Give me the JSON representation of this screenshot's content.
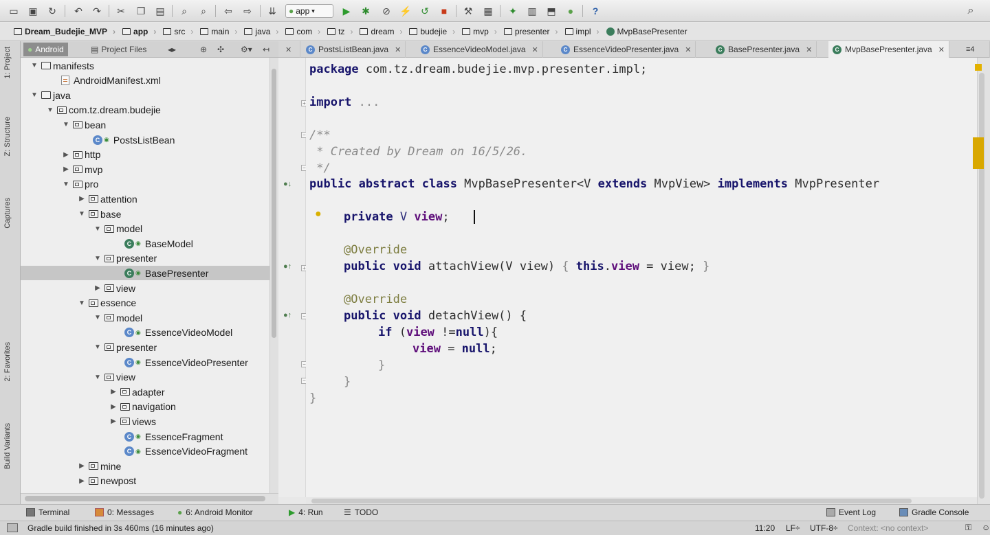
{
  "toolbar": {
    "run_config": "app",
    "buttons": [
      "open-icon",
      "save-all-icon",
      "sync-icon",
      "undo-icon",
      "redo-icon",
      "cut-icon",
      "copy-icon",
      "paste-icon",
      "find-icon",
      "replace-icon",
      "back-icon",
      "forward-icon",
      "make-project-icon",
      "run-icon",
      "debug-icon",
      "attach-debugger-icon",
      "apply-changes-icon",
      "rerun-icon",
      "stop-icon",
      "project-structure-icon",
      "sdk-manager-icon",
      "avd-manager-icon",
      "device-monitor-icon",
      "android-icon",
      "help-icon",
      "search-everywhere-icon"
    ]
  },
  "breadcrumb": [
    "Dream_Budejie_MVP",
    "app",
    "src",
    "main",
    "java",
    "com",
    "tz",
    "dream",
    "budejie",
    "mvp",
    "presenter",
    "impl",
    "MvpBasePresenter"
  ],
  "left_stripe": {
    "project": "1: Project",
    "structure": "Z: Structure",
    "captures": "Captures",
    "favorites": "2: Favorites",
    "build_variants": "Build Variants"
  },
  "project_panel": {
    "tab_android": "Android",
    "tab_project_files": "Project Files",
    "tree": [
      {
        "label": "manifests",
        "icon": "folder",
        "depth": 1,
        "toggle": "▼"
      },
      {
        "label": "AndroidManifest.xml",
        "icon": "xml",
        "depth": 2,
        "toggle": ""
      },
      {
        "label": "java",
        "icon": "folder",
        "depth": 1,
        "toggle": "▼"
      },
      {
        "label": "com.tz.dream.budejie",
        "icon": "package",
        "depth": 2,
        "toggle": "▼"
      },
      {
        "label": "bean",
        "icon": "package",
        "depth": 3,
        "toggle": "▼"
      },
      {
        "label": "PostsListBean",
        "icon": "class",
        "depth": 4,
        "toggle": ""
      },
      {
        "label": "http",
        "icon": "package",
        "depth": 3,
        "toggle": "▶"
      },
      {
        "label": "mvp",
        "icon": "package",
        "depth": 3,
        "toggle": "▶"
      },
      {
        "label": "pro",
        "icon": "package",
        "depth": 3,
        "toggle": "▼"
      },
      {
        "label": "attention",
        "icon": "package",
        "depth": 4,
        "toggle": "▶"
      },
      {
        "label": "base",
        "icon": "package",
        "depth": 4,
        "toggle": "▼"
      },
      {
        "label": "model",
        "icon": "package",
        "depth": 5,
        "toggle": "▼"
      },
      {
        "label": "BaseModel",
        "icon": "class-alt",
        "depth": 6,
        "toggle": ""
      },
      {
        "label": "presenter",
        "icon": "package",
        "depth": 5,
        "toggle": "▼"
      },
      {
        "label": "BasePresenter",
        "icon": "class-alt",
        "depth": 6,
        "toggle": "",
        "selected": true
      },
      {
        "label": "view",
        "icon": "package",
        "depth": 5,
        "toggle": "▶"
      },
      {
        "label": "essence",
        "icon": "package",
        "depth": 4,
        "toggle": "▼"
      },
      {
        "label": "model",
        "icon": "package",
        "depth": 5,
        "toggle": "▼"
      },
      {
        "label": "EssenceVideoModel",
        "icon": "class",
        "depth": 6,
        "toggle": ""
      },
      {
        "label": "presenter",
        "icon": "package",
        "depth": 5,
        "toggle": "▼"
      },
      {
        "label": "EssenceVideoPresenter",
        "icon": "class",
        "depth": 6,
        "toggle": ""
      },
      {
        "label": "view",
        "icon": "package",
        "depth": 5,
        "toggle": "▼"
      },
      {
        "label": "adapter",
        "icon": "package",
        "depth": 6,
        "toggle": "▶"
      },
      {
        "label": "navigation",
        "icon": "package",
        "depth": 6,
        "toggle": "▶"
      },
      {
        "label": "views",
        "icon": "package",
        "depth": 6,
        "toggle": "▶"
      },
      {
        "label": "EssenceFragment",
        "icon": "class",
        "depth": 6,
        "toggle": ""
      },
      {
        "label": "EssenceVideoFragment",
        "icon": "class",
        "depth": 6,
        "toggle": ""
      },
      {
        "label": "mine",
        "icon": "package",
        "depth": 4,
        "toggle": "▶"
      },
      {
        "label": "newpost",
        "icon": "package",
        "depth": 4,
        "toggle": "▶"
      }
    ]
  },
  "editor_tabs": [
    {
      "label": "PostsListBean.java",
      "icon": "class",
      "active": false
    },
    {
      "label": "EssenceVideoModel.java",
      "icon": "class",
      "active": false
    },
    {
      "label": "EssenceVideoPresenter.java",
      "icon": "class",
      "active": false
    },
    {
      "label": "BasePresenter.java",
      "icon": "class-alt",
      "active": false
    },
    {
      "label": "MvpBasePresenter.java",
      "icon": "class-alt",
      "active": true
    }
  ],
  "editor_tabs_overflow": "≡4",
  "code": {
    "package_kw": "package",
    "package_name": " com.tz.dream.budejie.mvp.presenter.impl;",
    "import_kw": "import",
    "import_rest": " ...",
    "comment_1": "/**",
    "comment_2": " * Created by Dream on 16/5/26.",
    "comment_3": " */",
    "class_decl": {
      "kw1": "public abstract class",
      "name": " MvpBasePresenter<V ",
      "kw2": "extends",
      "mid": " MvpView> ",
      "kw3": "implements",
      "tail": " MvpPresenter"
    },
    "field": {
      "kw": "private",
      "type": " V ",
      "name": "view",
      "end": ";"
    },
    "override_1": "@Override",
    "attach": {
      "kw": "public void",
      "sig": " attachView(V view) ",
      "body_open": "{ ",
      "this_kw": "this",
      "dot": ".",
      "field": "view",
      "rest": " = view; ",
      "body_close": "}"
    },
    "override_2": "@Override",
    "detach": {
      "kw": "public void",
      "sig": " detachView() {"
    },
    "if_line": {
      "kw": "if",
      "open": " (",
      "field": "view",
      "op": " !=",
      "null_kw": "null",
      "close": "){"
    },
    "assign_line": {
      "field": "view",
      "op": " = ",
      "null_kw": "null",
      "end": ";"
    },
    "close_if": "}",
    "close_method": "}",
    "close_class": "}"
  },
  "tool_windows": {
    "terminal": "Terminal",
    "messages": "0: Messages",
    "android_monitor": "6: Android Monitor",
    "run": "4: Run",
    "todo": "TODO",
    "event_log": "Event Log",
    "gradle_console": "Gradle Console"
  },
  "status": {
    "message": "Gradle build finished in 3s 460ms (16 minutes ago)",
    "position": "11:20",
    "line_sep": "LF÷",
    "encoding": "UTF-8÷",
    "context": "Context: <no context>"
  },
  "colors": {
    "keyword": "#17146b",
    "comment": "#8a8a8a",
    "annotation": "#7d7d40",
    "field": "#5e0d7a",
    "selection": "#c6c6c6",
    "comment_highlight": "#e5dcb2"
  }
}
